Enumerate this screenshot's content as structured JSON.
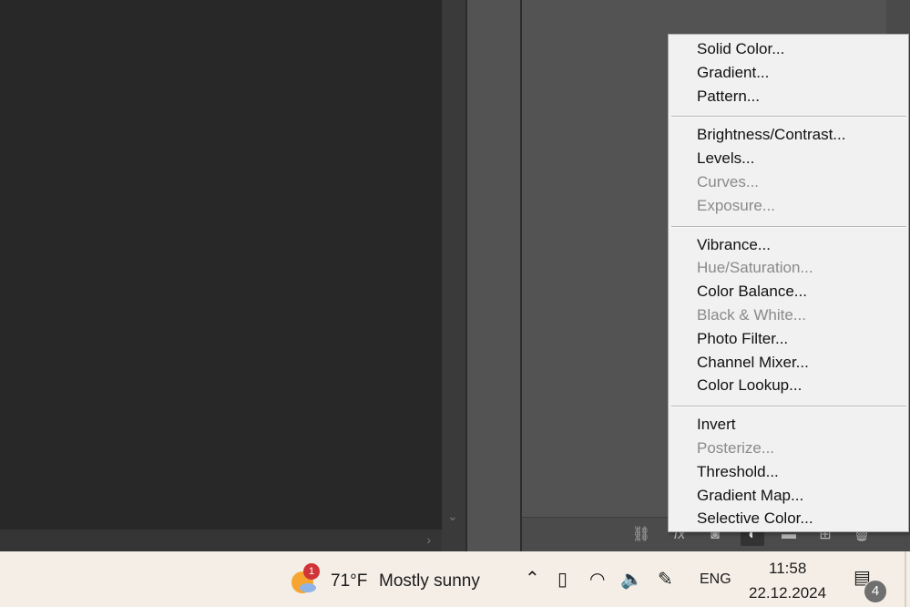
{
  "menu": {
    "groups": [
      [
        {
          "label": "Solid Color...",
          "enabled": true
        },
        {
          "label": "Gradient...",
          "enabled": true
        },
        {
          "label": "Pattern...",
          "enabled": true
        }
      ],
      [
        {
          "label": "Brightness/Contrast...",
          "enabled": true
        },
        {
          "label": "Levels...",
          "enabled": true
        },
        {
          "label": "Curves...",
          "enabled": false
        },
        {
          "label": "Exposure...",
          "enabled": false
        }
      ],
      [
        {
          "label": "Vibrance...",
          "enabled": true
        },
        {
          "label": "Hue/Saturation...",
          "enabled": false
        },
        {
          "label": "Color Balance...",
          "enabled": true
        },
        {
          "label": "Black & White...",
          "enabled": false
        },
        {
          "label": "Photo Filter...",
          "enabled": true
        },
        {
          "label": "Channel Mixer...",
          "enabled": true
        },
        {
          "label": "Color Lookup...",
          "enabled": true
        }
      ],
      [
        {
          "label": "Invert",
          "enabled": true
        },
        {
          "label": "Posterize...",
          "enabled": false
        },
        {
          "label": "Threshold...",
          "enabled": true
        },
        {
          "label": "Gradient Map...",
          "enabled": true
        },
        {
          "label": "Selective Color...",
          "enabled": true
        }
      ]
    ]
  },
  "panel_footer": {
    "icons": [
      "link-icon",
      "fx-icon",
      "mask-icon",
      "adjustment-layer-icon",
      "group-icon",
      "new-layer-icon",
      "trash-icon"
    ]
  },
  "taskbar": {
    "weather": {
      "badge": "1",
      "temp": "71°F",
      "condition": "Mostly sunny"
    },
    "language": "ENG",
    "time": "11:58",
    "date": "22.12.2024",
    "notifications": "4"
  },
  "colors": {
    "canvas": "#282828",
    "panel": "#535353",
    "menu_bg": "#f1f1f1",
    "disabled_text": "#8a8a8a",
    "taskbar": "#f4eee6",
    "badge_red": "#d13438"
  }
}
